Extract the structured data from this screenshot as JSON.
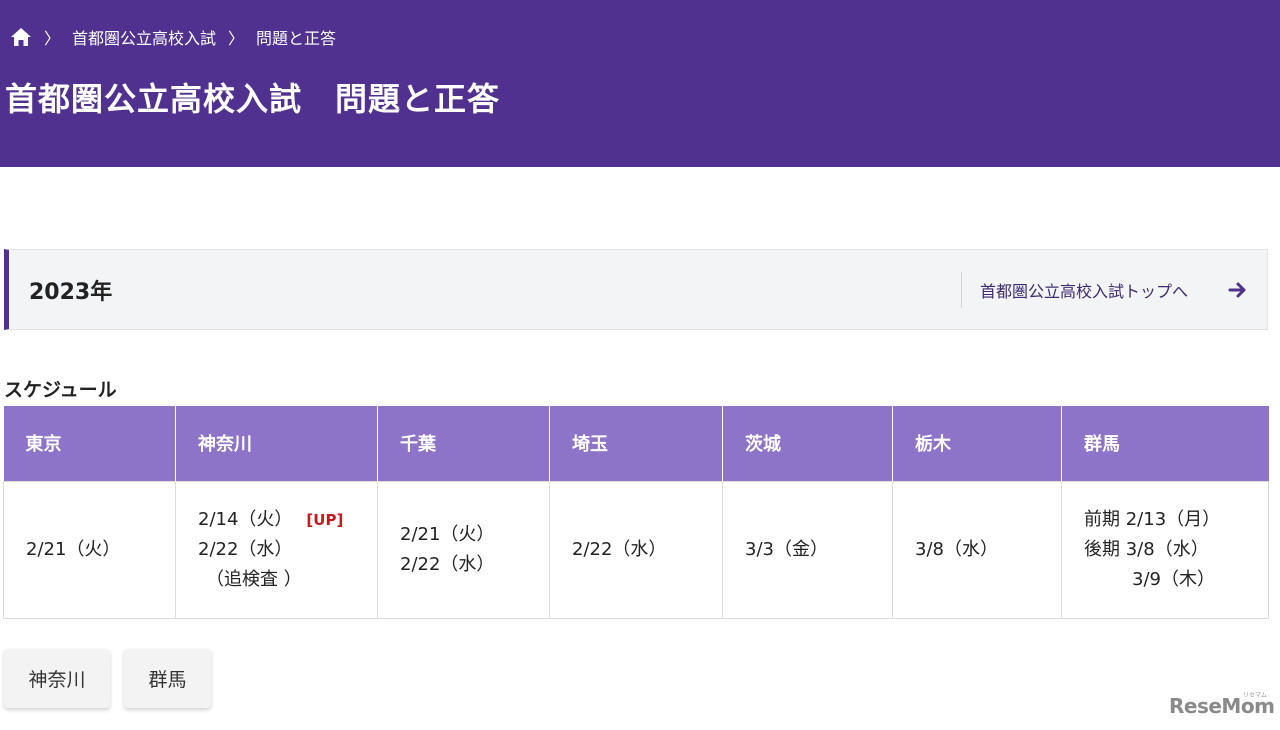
{
  "breadcrumb": {
    "items": [
      "首都圏公立高校入試",
      "問題と正答"
    ]
  },
  "page": {
    "title": "首都圏公立高校入試　問題と正答"
  },
  "year_section": {
    "year": "2023年",
    "top_link": "首都圏公立高校入試トップへ"
  },
  "schedule": {
    "title": "スケジュール",
    "headers": [
      "東京",
      "神奈川",
      "千葉",
      "埼玉",
      "茨城",
      "栃木",
      "群馬"
    ],
    "tokyo": "2/21（火）",
    "kanagawa": {
      "line1": "2/14（火）",
      "badge": "[UP]",
      "line2": "2/22（水）",
      "line3": "（追検査 ）"
    },
    "chiba": {
      "line1": "2/21（火）",
      "line2": "2/22（水）"
    },
    "saitama": "2/22（水）",
    "ibaraki": "3/3（金）",
    "tochigi": "3/8（水）",
    "gunma": {
      "line1": "前期 2/13（月）",
      "line2": "後期 3/8（水）",
      "line3": "3/9（木）"
    }
  },
  "buttons": [
    "神奈川",
    "群馬"
  ],
  "logo": {
    "text": "ReseMom",
    "kana": "リセマム"
  },
  "colors": {
    "header_bg": "#50318f",
    "table_header_bg": "#8e74c8",
    "up_badge": "#c8161d"
  }
}
